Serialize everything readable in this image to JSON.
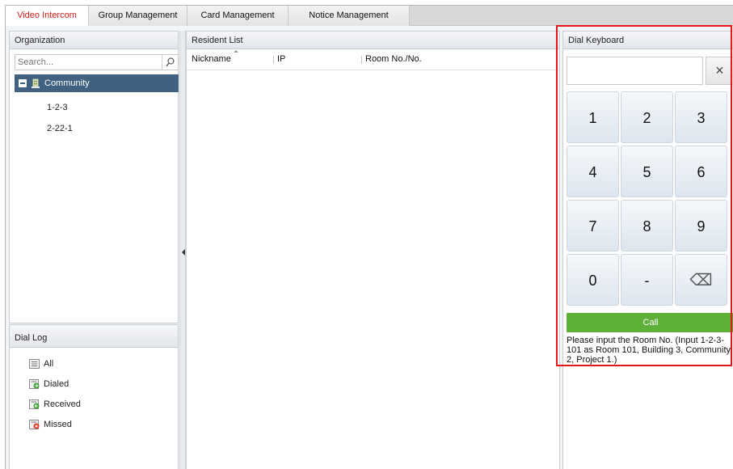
{
  "tabs": [
    {
      "label": "Video Intercom",
      "active": true
    },
    {
      "label": "Group Management",
      "active": false
    },
    {
      "label": "Card Management",
      "active": false
    },
    {
      "label": "Notice Management",
      "active": false
    }
  ],
  "organization": {
    "title": "Organization",
    "search_placeholder": "Search...",
    "search_icon": "search-icon",
    "root": {
      "label": "Community",
      "icon": "building-icon",
      "expanded": true
    },
    "children": [
      "1-2-3",
      "2-22-1"
    ]
  },
  "dial_log": {
    "title": "Dial Log",
    "items": [
      {
        "label": "All",
        "icon": "log-all-icon"
      },
      {
        "label": "Dialed",
        "icon": "log-dialed-icon"
      },
      {
        "label": "Received",
        "icon": "log-received-icon"
      },
      {
        "label": "Missed",
        "icon": "log-missed-icon"
      }
    ]
  },
  "resident_list": {
    "title": "Resident List",
    "columns": [
      "Nickname",
      "IP",
      "Room No./No."
    ],
    "rows": []
  },
  "dial_keyboard": {
    "title": "Dial Keyboard",
    "input_value": "",
    "clear_label": "×",
    "keys": [
      "1",
      "2",
      "3",
      "4",
      "5",
      "6",
      "7",
      "8",
      "9",
      "0",
      "-",
      "⌫"
    ],
    "call_label": "Call",
    "hint": "Please input the Room No. (Input 1-2-3-101 as Room 101, Building 3, Community 2, Project 1.)"
  },
  "colors": {
    "active_tab_text": "#d11a1a",
    "tree_selected_bg": "#40617f",
    "call_button": "#5eb039",
    "highlight_border": "#e5161c"
  }
}
